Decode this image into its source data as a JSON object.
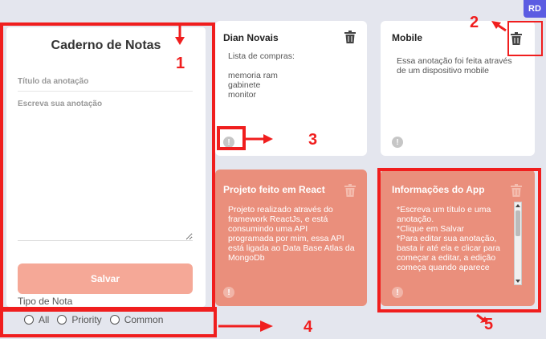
{
  "badge": "RD",
  "sidebar": {
    "title": "Caderno de Notas",
    "title_placeholder": "Título da anotação",
    "note_placeholder": "Escreva sua anotação",
    "save_label": "Salvar",
    "tipo_label": "Tipo de Nota",
    "filters": [
      "All",
      "Priority",
      "Common"
    ]
  },
  "cards": [
    {
      "title": "Dian Novais",
      "body": "Lista de compras:\n\nmemoria ram\ngabinete\nmonitor",
      "style": "white"
    },
    {
      "title": "Mobile",
      "body": "Essa anotação foi feita através de um dispositivo mobile",
      "style": "white"
    },
    {
      "title": "Projeto feito em React",
      "body": "Projeto realizado através do framework ReactJs, e está consumindo uma API programada por mim, essa API está ligada ao Data Base Atlas da MongoDb",
      "style": "salmon"
    },
    {
      "title": "Informações do App",
      "body": "*Escreva um título e uma anotação.\n*Clique em Salvar\n*Para editar sua anotação, basta ir até ela e clicar para começar a editar, a edição começa quando aparece",
      "style": "salmon"
    }
  ],
  "annotations": [
    "1",
    "2",
    "3",
    "4",
    "5"
  ],
  "colors": {
    "accent": "#f01e1e",
    "salmon": "#ea8f7c",
    "save_button": "#f5a897",
    "badge": "#5b5ce2"
  }
}
